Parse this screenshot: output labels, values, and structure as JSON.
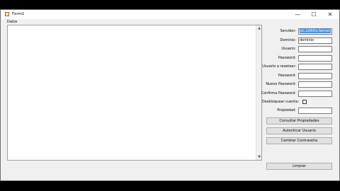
{
  "window": {
    "title": "Form1",
    "minimize_glyph": "—",
    "maximize_glyph": "☐",
    "close_glyph": "✕"
  },
  "datos": {
    "label": "Datos",
    "value": ""
  },
  "form": {
    "servidor": {
      "label": "Servidor:",
      "value": "dc.LDAP.o.Server"
    },
    "dominio": {
      "label": "Dominio:",
      "value": "dominio"
    },
    "usuario": {
      "label": "Usuario:",
      "value": ""
    },
    "password": {
      "label": "Password:",
      "value": ""
    },
    "usuario_reset": {
      "label": "Usuario a resetear:",
      "value": ""
    },
    "password_reset": {
      "label": "Password:",
      "value": ""
    },
    "nuevo_password": {
      "label": "Nuevo Password:",
      "value": ""
    },
    "confirma_password": {
      "label": "Confirma Password:",
      "value": ""
    },
    "desbloquear": {
      "label": "Desbloquear cuenta:",
      "checked": false
    },
    "propiedad": {
      "label": "Propiedad:",
      "value": ""
    }
  },
  "buttons": {
    "consultar": "Consultar Propiedades",
    "autenticar": "Autenticar Usuario",
    "cambiar": "Cambiar Contraseña",
    "limpiar": "Limpiar"
  }
}
